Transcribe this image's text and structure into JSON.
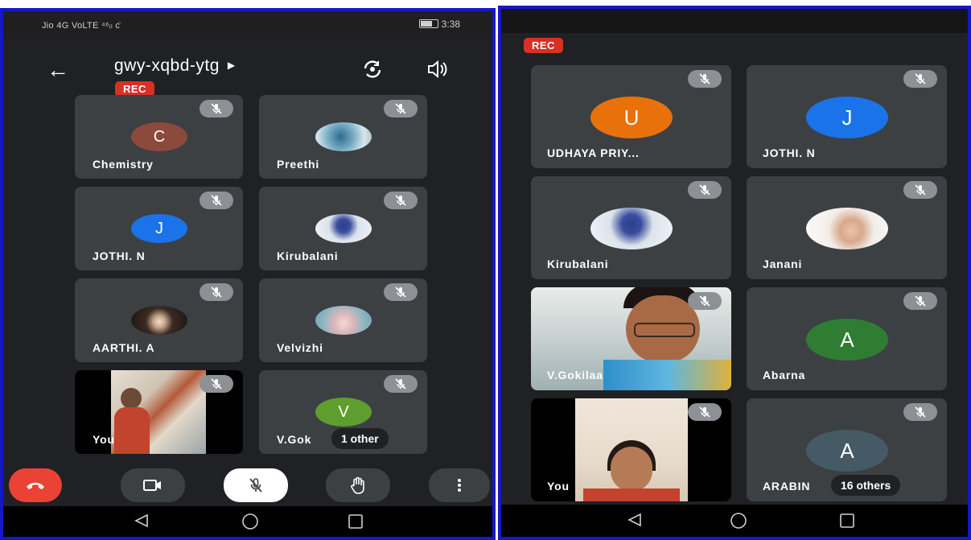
{
  "left": {
    "status": {
      "carrier": "Jio 4G VoLTE ⁴⁶ᵢₗ ᴄ̈",
      "time": "3:38"
    },
    "meeting_code": "gwy-xqbd-ytg",
    "rec_label": "REC",
    "tiles": [
      {
        "name": "Chemistry",
        "initial": "C",
        "avatar_color": "#8b4a3c"
      },
      {
        "name": "Preethi",
        "initial": "",
        "avatar_color": "#6a8a9c"
      },
      {
        "name": "JOTHI. N",
        "initial": "J",
        "avatar_color": "#1a73e8"
      },
      {
        "name": "Kirubalani",
        "initial": "",
        "avatar_color": "#c9d3de"
      },
      {
        "name": "AARTHI. A",
        "initial": "",
        "avatar_color": "#2b2320"
      },
      {
        "name": "Velvizhi",
        "initial": "",
        "avatar_color": "#8fb7c4"
      },
      {
        "name": "You",
        "initial": "",
        "avatar_color": ""
      },
      {
        "name": "V.Gok",
        "initial": "V",
        "avatar_color": "#5e9e2e"
      }
    ],
    "others_label": "1 other"
  },
  "right": {
    "rec_label": "REC",
    "tiles": [
      {
        "name": "UDHAYA PRIY...",
        "initial": "U",
        "avatar_color": "#e8710a"
      },
      {
        "name": "JOTHI. N",
        "initial": "J",
        "avatar_color": "#1a73e8"
      },
      {
        "name": "Kirubalani",
        "initial": "",
        "avatar_color": "#c9d3de"
      },
      {
        "name": "Janani",
        "initial": "",
        "avatar_color": "#e8dcd2"
      },
      {
        "name": "V.Gokilaa",
        "initial": "",
        "avatar_color": ""
      },
      {
        "name": "Abarna",
        "initial": "A",
        "avatar_color": "#2e7d32"
      },
      {
        "name": "You",
        "initial": "",
        "avatar_color": ""
      },
      {
        "name": "ARABIN",
        "initial": "A",
        "avatar_color": "#455a64"
      }
    ],
    "others_label": "16 others"
  },
  "colors": {
    "end_call": "#ea4335",
    "rec": "#d93025",
    "tile": "#3c4043",
    "frame": "#1518c4"
  },
  "icons": [
    "back-arrow-icon",
    "flip-camera-icon",
    "speaker-icon",
    "mic-off-icon",
    "end-call-icon",
    "camera-icon",
    "raise-hand-icon",
    "more-vert-icon",
    "nav-back-icon",
    "nav-home-icon",
    "nav-recents-icon"
  ]
}
